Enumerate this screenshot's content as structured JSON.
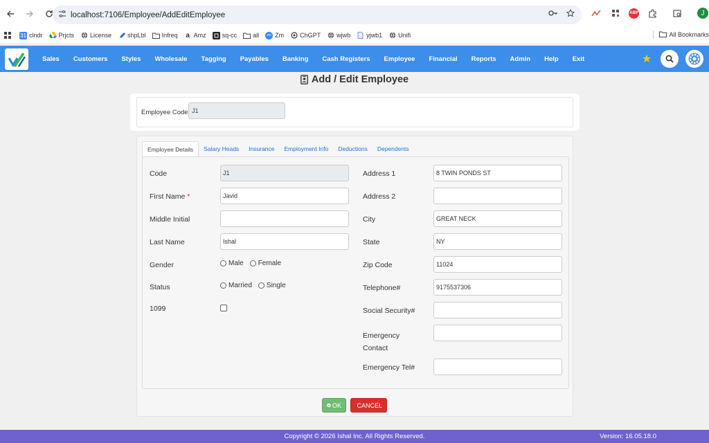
{
  "browser": {
    "url": "localhost:7106/Employee/AddEditEmployee",
    "bookmarks": [
      "clndr",
      "Prjcts",
      "License",
      "shpLbl",
      "Infreq",
      "Amz",
      "sq-cc",
      "all",
      "Zm",
      "ChGPT",
      "wjwb",
      "yjwb1",
      "Unifi"
    ],
    "all_bookmarks": "All Bookmarks",
    "profile_initial": "J"
  },
  "nav": {
    "menu": [
      "Sales",
      "Customers",
      "Styles",
      "Wholesale",
      "Tagging",
      "Payables",
      "Banking",
      "Cash Registers",
      "Employee",
      "Financial",
      "Reports",
      "Admin",
      "Help",
      "Exit"
    ]
  },
  "page": {
    "title": "Add / Edit Employee",
    "employee_code_label": "Employee Code",
    "employee_code_value": "J1"
  },
  "tabs": [
    "Employee Details",
    "Salary Heads",
    "Insurance",
    "Employment Info",
    "Deductions",
    "Dependents"
  ],
  "form": {
    "left": {
      "code": {
        "label": "Code",
        "value": "J1"
      },
      "first_name": {
        "label": "First Name",
        "required_mark": "*",
        "value": "Javid"
      },
      "middle_initial": {
        "label": "Middle Initial",
        "value": ""
      },
      "last_name": {
        "label": "Last Name",
        "value": "Ishal"
      },
      "gender": {
        "label": "Gender",
        "options": [
          "Male",
          "Female"
        ]
      },
      "status": {
        "label": "Status",
        "options": [
          "Married",
          "Single"
        ]
      },
      "form1099": {
        "label": "1099",
        "checked": false
      }
    },
    "right": {
      "address1": {
        "label": "Address 1",
        "value": "8 TWIN PONDS ST"
      },
      "address2": {
        "label": "Address 2",
        "value": ""
      },
      "city": {
        "label": "City",
        "value": "GREAT NECK"
      },
      "state": {
        "label": "State",
        "value": "NY"
      },
      "zip": {
        "label": "Zip Code",
        "value": "11024"
      },
      "telephone": {
        "label": "Telephone#",
        "value": "9175537306"
      },
      "ssn": {
        "label": "Social Security#",
        "value": ""
      },
      "emergency_contact": {
        "label_line1": "Emergency",
        "label_line2": "Contact",
        "value": ""
      },
      "emergency_tel": {
        "label": "Emergency Tel#",
        "value": ""
      }
    }
  },
  "buttons": {
    "ok": "OK",
    "cancel": "CANCEL"
  },
  "footer": {
    "copyright": "Copyright © 2026 Ishal Inc. All Rights Reserved.",
    "version": "Version: 16.05.18.0"
  },
  "colors": {
    "navbar": "#3d8eea",
    "footer": "#6f62cf",
    "ok": "#6fbf73",
    "cancel": "#d9302c"
  }
}
